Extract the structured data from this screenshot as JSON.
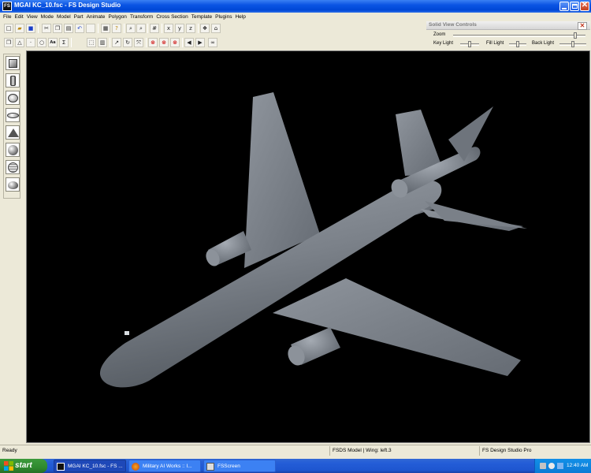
{
  "window": {
    "app_icon_label": "FS",
    "title": "MGAI KC_10.fsc - FS Design Studio"
  },
  "menu": {
    "items": [
      "File",
      "Edit",
      "View",
      "Mode",
      "Model",
      "Part",
      "Animate",
      "Polygon",
      "Transform",
      "Cross Section",
      "Template",
      "Plugins",
      "Help"
    ]
  },
  "toolbar1": {
    "icons": [
      "new-icon",
      "open-icon",
      "save-icon",
      "cut-icon",
      "copy-icon",
      "paste-icon",
      "undo-icon",
      "blank-icon",
      "print-icon",
      "help-icon",
      "zoom-in-icon",
      "zoom-out-icon",
      "grid-icon",
      "axis-x-icon",
      "axis-y-icon",
      "axis-z-icon",
      "view-3d-icon",
      "view-box-icon"
    ]
  },
  "toolbar2": {
    "icons": [
      "copy-part-icon",
      "triangle-icon",
      "point-icon",
      "circle-icon",
      "text-icon",
      "sigma-icon",
      "select-box-icon",
      "hatch-icon",
      "arrow-icon",
      "rotate-icon",
      "scale-icon",
      "no-select-icon",
      "no-move-icon",
      "no-edit-icon",
      "prev-icon",
      "next-icon",
      "binoculars-icon"
    ]
  },
  "solid_view": {
    "title": "Solid View Controls",
    "zoom_label": "Zoom",
    "key_light_label": "Key Light",
    "fill_light_label": "Fill Light",
    "back_light_label": "Back Light",
    "zoom_level": 0.93,
    "key_light_level": 0.5,
    "fill_light_level": 0.5,
    "back_light_level": 0.5,
    "close_glyph": "✕"
  },
  "palette": {
    "shapes": [
      "cube-icon",
      "cylinder-icon",
      "disc-icon",
      "ellipse-icon",
      "cone-icon",
      "sphere-icon",
      "sphere-mesh-icon",
      "hemisphere-icon"
    ]
  },
  "viewport": {
    "model": "kc10-aircraft",
    "colors": {
      "background": "#000000",
      "fuselage": "#7b8189",
      "shadow": "#535960",
      "highlight": "#9aa0a8"
    }
  },
  "status": {
    "ready": "Ready",
    "model_info": "FSDS Model | Wing: left.3",
    "app": "FS Design Studio Pro"
  },
  "taskbar": {
    "start_label": "start",
    "tasks": [
      {
        "label": "MGAI KC_10.fsc - FS ..."
      },
      {
        "label": "Military AI Works :: I..."
      },
      {
        "label": "FSScreen"
      }
    ],
    "clock": "12:40 AM"
  }
}
